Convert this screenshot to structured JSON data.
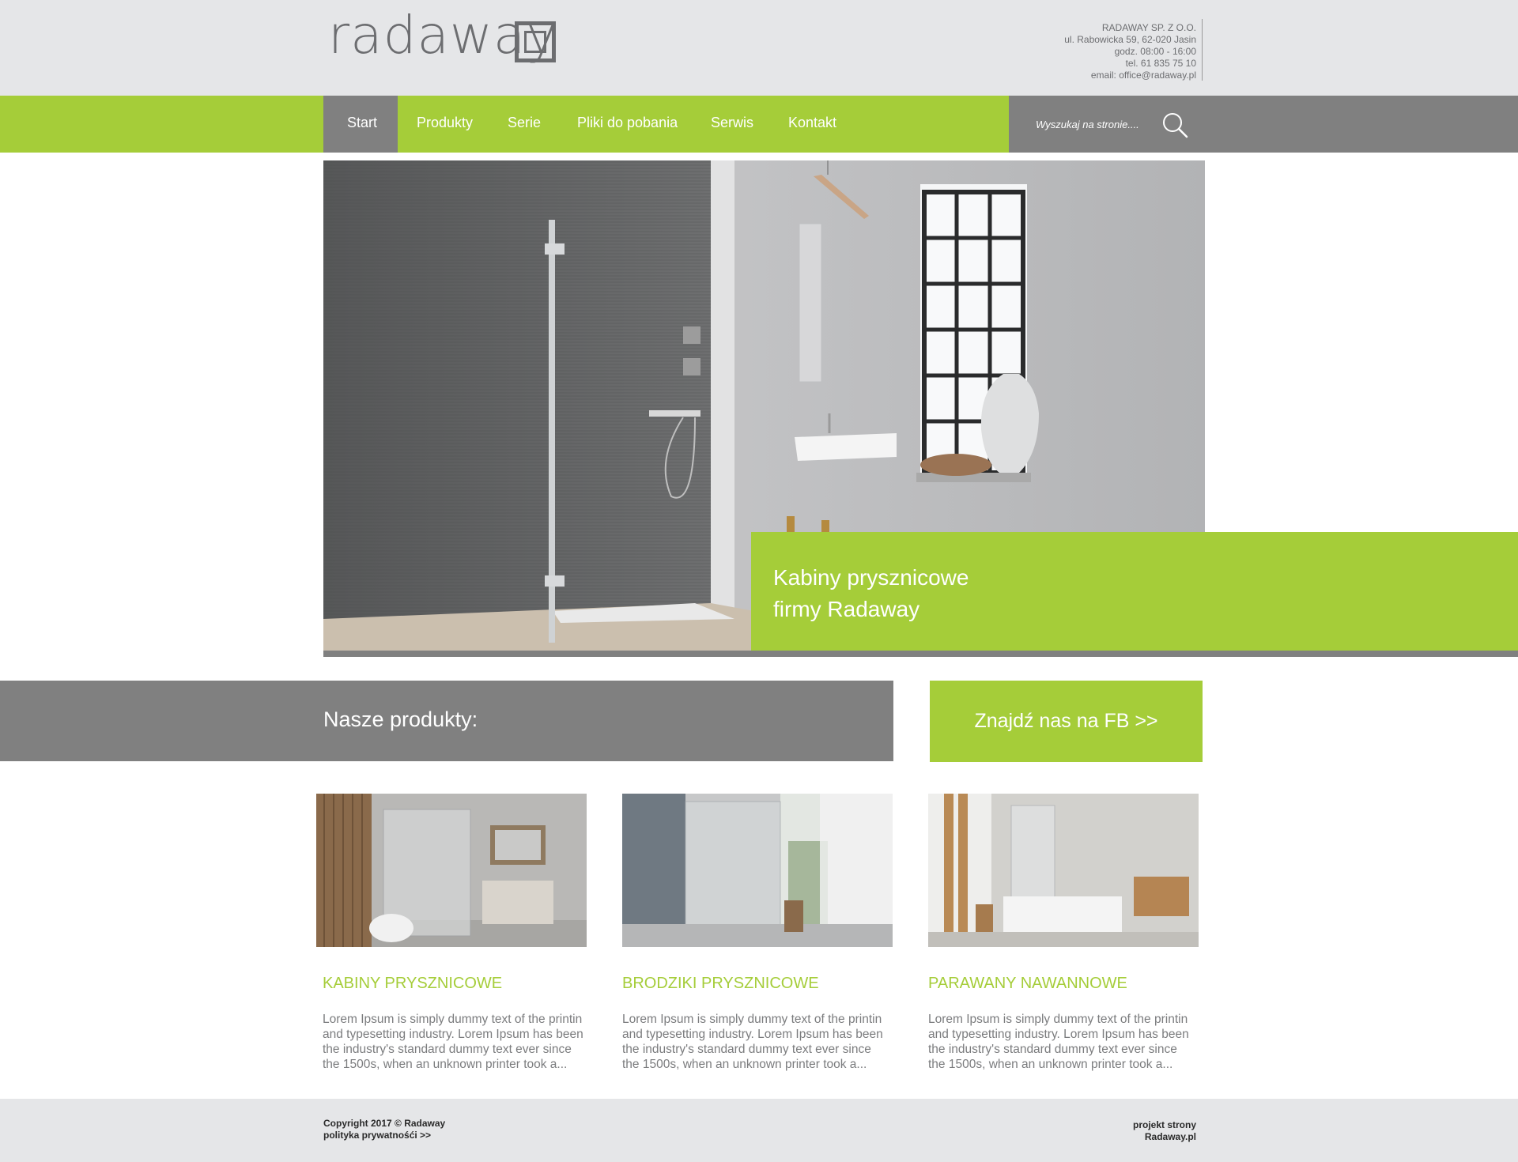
{
  "header": {
    "logo_text": "radaway",
    "contact": {
      "company": "RADAWAY SP. Z O.O.",
      "address": "ul. Rabowicka 59, 62-020 Jasin",
      "hours": "godz. 08:00 - 16:00",
      "phone": "tel. 61 835 75 10",
      "email": "email: office@radaway.pl"
    }
  },
  "nav": {
    "items": [
      "Start",
      "Produkty",
      "Serie",
      "Pliki do pobania",
      "Serwis",
      "Kontakt"
    ],
    "active": "Start",
    "search_placeholder": "Wyszukaj na stronie...."
  },
  "hero": {
    "caption_line1": "Kabiny prysznicowe",
    "caption_line2": "firmy Radaway"
  },
  "products": {
    "title": "Nasze produkty:",
    "fb_link": "Znajdź nas na FB >>",
    "cards": [
      {
        "title": "KABINY PRYSZNICOWE",
        "description": "Lorem Ipsum is simply dummy text of the printin and typesetting industry. Lorem Ipsum has been the industry's standard dummy text ever since the 1500s, when an unknown printer took a..."
      },
      {
        "title": "BRODZIKI PRYSZNICOWE",
        "description": "Lorem Ipsum is simply dummy text of the printin and typesetting industry. Lorem Ipsum has been the industry's standard dummy text ever since the 1500s, when an unknown printer took a..."
      },
      {
        "title": "PARAWANY NAWANNOWE",
        "description": "Lorem Ipsum is simply dummy text of the printin and typesetting industry. Lorem Ipsum has been the industry's standard dummy text ever since the 1500s, when an unknown printer took a..."
      }
    ]
  },
  "footer": {
    "copyright": "Copyright 2017 © Radaway",
    "privacy": "polityka prywatnośći >>",
    "credit_line1": "projekt strony",
    "credit_line2": "Radaway.pl"
  },
  "colors": {
    "brand_green": "#a5cd39",
    "nav_grey": "#808080",
    "header_bg": "#e5e6e8",
    "text_grey": "#7b7c7e"
  }
}
